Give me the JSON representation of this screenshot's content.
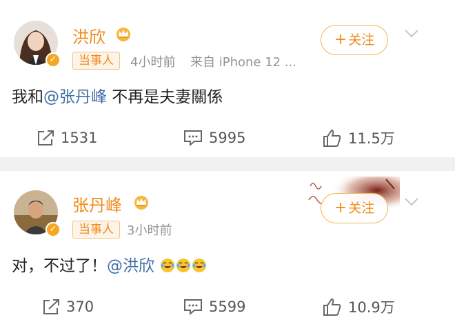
{
  "posts": [
    {
      "username": "洪欣",
      "tag": "当事人",
      "time": "4小时前",
      "source": "来自 iPhone 12 ...",
      "follow_label": "关注",
      "content_before": "我和",
      "content_mention": "@张丹峰",
      "content_after": " 不再是夫妻關係",
      "repost_count": "1531",
      "comment_count": "5995",
      "like_count": "11.5万"
    },
    {
      "username": "张丹峰",
      "tag": "当事人",
      "time": "3小时前",
      "follow_label": "关注",
      "content_before": "对，不过了！",
      "content_mention": "@洪欣",
      "emoji_count": 3,
      "repost_count": "370",
      "comment_count": "5599",
      "like_count": "10.9万"
    }
  ],
  "colors": {
    "username": "#f08a19",
    "mention": "#3c6ea5",
    "meta": "#939393",
    "separator": "#f1f1f1"
  },
  "icons": [
    "verified-badge-icon",
    "crown-icon",
    "chevron-down-icon",
    "repost-icon",
    "comment-icon",
    "like-icon",
    "laugh-cry-emoji-icon"
  ]
}
